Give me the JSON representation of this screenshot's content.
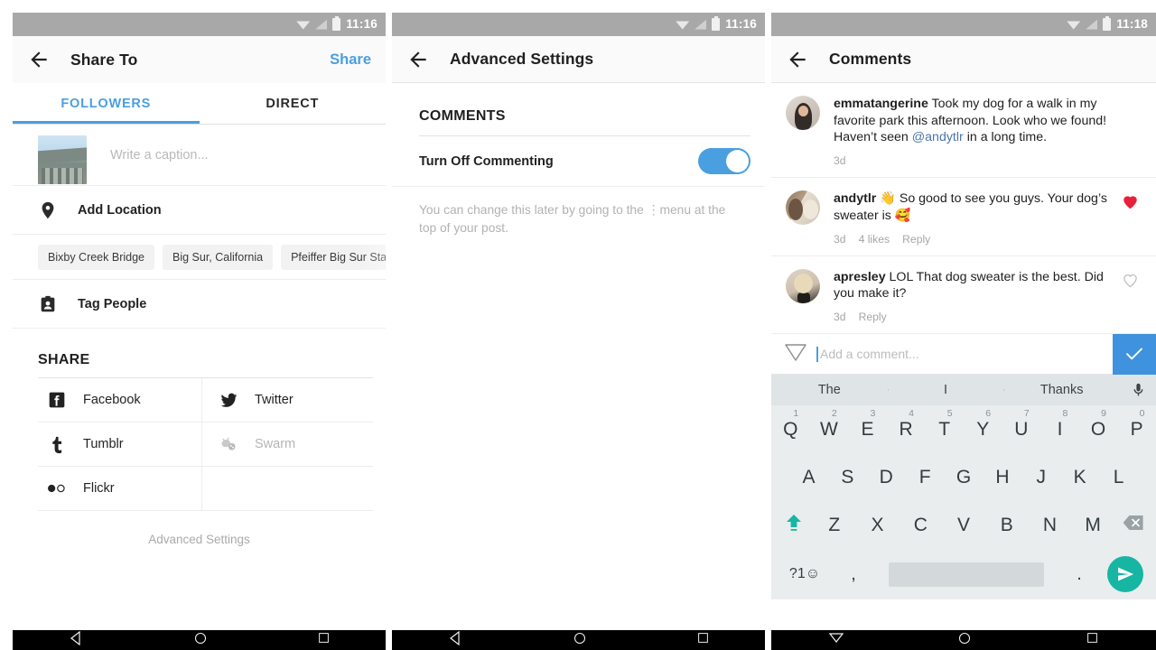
{
  "panels": {
    "share": {
      "status": {
        "time": "11:16"
      },
      "appbar": {
        "title": "Share To",
        "action": "Share",
        "back_icon": "back-arrow-icon"
      },
      "tabs": [
        {
          "label": "FOLLOWERS",
          "active": true
        },
        {
          "label": "DIRECT",
          "active": false
        }
      ],
      "caption": {
        "placeholder": "Write a caption...",
        "thumb_icon": "post-thumbnail"
      },
      "location_row": {
        "label": "Add Location",
        "icon": "location-pin-icon"
      },
      "location_chips": [
        "Bixby Creek Bridge",
        "Big Sur, California",
        "Pfeiffer Big Sur State Park"
      ],
      "tag_row": {
        "label": "Tag People",
        "icon": "tag-people-icon"
      },
      "share_section": {
        "title": "SHARE"
      },
      "share_targets": [
        {
          "label": "Facebook",
          "icon": "facebook-icon",
          "disabled": false
        },
        {
          "label": "Twitter",
          "icon": "twitter-icon",
          "disabled": false
        },
        {
          "label": "Tumblr",
          "icon": "tumblr-icon",
          "disabled": false
        },
        {
          "label": "Swarm",
          "icon": "swarm-icon",
          "disabled": true
        },
        {
          "label": "Flickr",
          "icon": "flickr-icon",
          "disabled": false
        }
      ],
      "advanced_link": "Advanced Settings"
    },
    "advanced": {
      "status": {
        "time": "11:16"
      },
      "appbar": {
        "title": "Advanced Settings",
        "back_icon": "back-arrow-icon"
      },
      "section_title": "COMMENTS",
      "toggle_row": {
        "label": "Turn Off Commenting",
        "state": "on",
        "color": "#4a9fe0"
      },
      "hint_before": "You can change this later by going to the",
      "hint_menu_icon": "overflow-menu-icon",
      "hint_after": "menu at the top of your post."
    },
    "comments": {
      "status": {
        "time": "11:18"
      },
      "appbar": {
        "title": "Comments",
        "back_icon": "back-arrow-icon"
      },
      "items": [
        {
          "avatar": "avatar-emmatangerine",
          "user": "emmatangerine",
          "text_before": " Took my dog for a walk in my favorite park this afternoon. Look who we found! Haven’t seen ",
          "mention": "@andytlr",
          "text_after": " in a long time.",
          "time": "3d",
          "likes": "",
          "reply": "",
          "heart": "none"
        },
        {
          "avatar": "avatar-andytlr",
          "user": "andytlr",
          "text_before": " 👋 So good to see you guys. Your dog’s sweater is 🥰",
          "mention": "",
          "text_after": "",
          "time": "3d",
          "likes": "4 likes",
          "reply": "Reply",
          "heart": "filled"
        },
        {
          "avatar": "avatar-apresley",
          "user": "apresley",
          "text_before": " LOL That dog sweater is the best. Did you make it?",
          "mention": "",
          "text_after": "",
          "time": "3d",
          "likes": "",
          "reply": "Reply",
          "heart": "outline"
        }
      ],
      "compose": {
        "icon": "send-outline-icon",
        "placeholder": "Add a comment...",
        "submit_icon": "check-icon",
        "submit_color": "#3f92dd"
      },
      "keyboard": {
        "suggestions": [
          "The",
          "I",
          "Thanks"
        ],
        "mic_icon": "microphone-icon",
        "row1": [
          {
            "key": "Q",
            "num": "1"
          },
          {
            "key": "W",
            "num": "2"
          },
          {
            "key": "E",
            "num": "3"
          },
          {
            "key": "R",
            "num": "4"
          },
          {
            "key": "T",
            "num": "5"
          },
          {
            "key": "Y",
            "num": "6"
          },
          {
            "key": "U",
            "num": "7"
          },
          {
            "key": "I",
            "num": "8"
          },
          {
            "key": "O",
            "num": "9"
          },
          {
            "key": "P",
            "num": "0"
          }
        ],
        "row2": [
          "A",
          "S",
          "D",
          "F",
          "G",
          "H",
          "J",
          "K",
          "L"
        ],
        "row3": [
          "Z",
          "X",
          "C",
          "V",
          "B",
          "N",
          "M"
        ],
        "shift_icon": "shift-key-icon",
        "backspace_icon": "backspace-key-icon",
        "symbols_key": "?1☺",
        "comma_key": ",",
        "period_key": ".",
        "send_icon": "send-key-icon",
        "send_color": "#16b6a3"
      }
    }
  },
  "navbar": {
    "back_icon": "nav-back-icon",
    "home_icon": "nav-home-icon",
    "recents_icon": "nav-recents-icon"
  }
}
